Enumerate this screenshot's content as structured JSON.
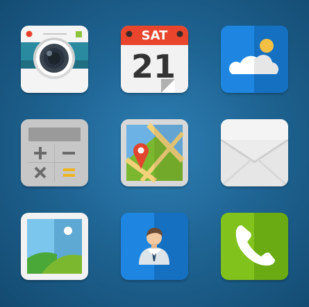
{
  "colors": {
    "background": "#1f6594",
    "camera_teal": "#2a8aa0",
    "calendar_red": "#e8452c",
    "weather_blue": "#1e86e0",
    "calculator_gray": "#c7c7c7",
    "maps_green": "#7cb82f",
    "mail_white": "#ececec",
    "gallery_sky": "#6ec3ec",
    "contacts_blue": "#1e86e0",
    "phone_green": "#82c21d"
  },
  "apps": {
    "camera": {
      "icon": "camera-icon"
    },
    "calendar": {
      "icon": "calendar-icon",
      "day": "SAT",
      "date": "21"
    },
    "weather": {
      "icon": "weather-icon"
    },
    "calculator": {
      "icon": "calculator-icon"
    },
    "maps": {
      "icon": "maps-icon"
    },
    "mail": {
      "icon": "mail-icon"
    },
    "gallery": {
      "icon": "gallery-icon"
    },
    "contacts": {
      "icon": "contacts-icon"
    },
    "phone": {
      "icon": "phone-icon"
    }
  }
}
